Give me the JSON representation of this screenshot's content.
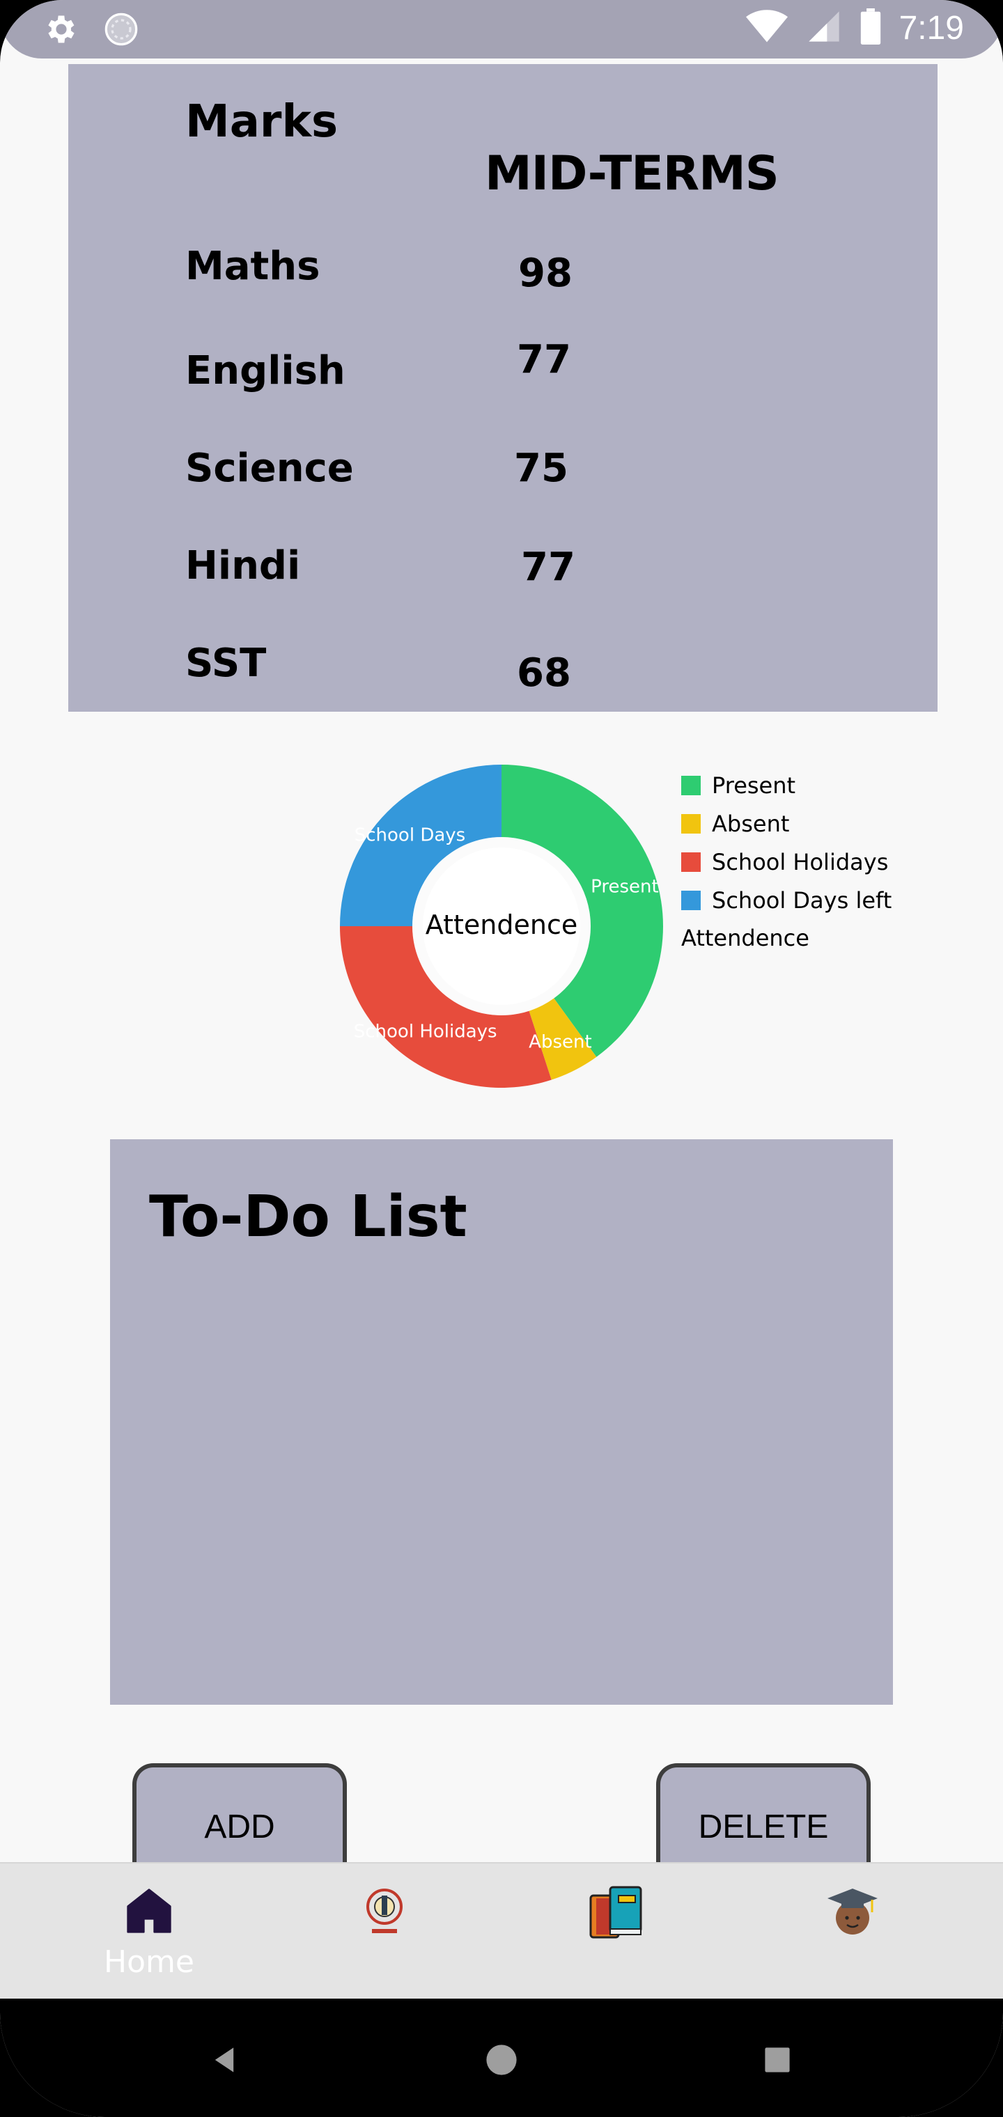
{
  "status_bar": {
    "time": "7:19",
    "icons": [
      "settings-gear-icon",
      "sync-circle-icon",
      "wifi-icon",
      "cellular-signal-icon",
      "battery-icon"
    ]
  },
  "marks": {
    "title": "Marks",
    "term": "MID-TERMS",
    "subjects": [
      {
        "name": "Maths",
        "score": "98"
      },
      {
        "name": "English",
        "score": "77"
      },
      {
        "name": "Science",
        "score": "75"
      },
      {
        "name": "Hindi",
        "score": "77"
      },
      {
        "name": "SST",
        "score": "68"
      }
    ]
  },
  "chart_data": {
    "type": "pie",
    "style": "donut",
    "center_label": "Attendence",
    "legend_title": "Attendence",
    "legend_position": "right",
    "slices": [
      {
        "label": "Present",
        "value": 40,
        "color": "#2ecc71"
      },
      {
        "label": "Absent",
        "value": 5,
        "color": "#f1c40f"
      },
      {
        "label": "School Holidays",
        "value": 30,
        "color": "#e74c3c"
      },
      {
        "label": "School Days left",
        "value": 25,
        "color": "#3498db"
      }
    ],
    "slice_text": [
      "Present",
      "Absent",
      "School Holidays",
      "School Days"
    ]
  },
  "todo": {
    "title": "To-Do List"
  },
  "buttons": {
    "add": "ADD",
    "delete": "DELETE"
  },
  "bottom_nav": {
    "items": [
      {
        "label": "Home",
        "icon": "home-icon",
        "active": true
      },
      {
        "label": "",
        "icon": "school-logo-icon",
        "active": false
      },
      {
        "label": "",
        "icon": "books-icon",
        "active": false
      },
      {
        "label": "",
        "icon": "graduate-avatar-icon",
        "active": false
      }
    ]
  }
}
